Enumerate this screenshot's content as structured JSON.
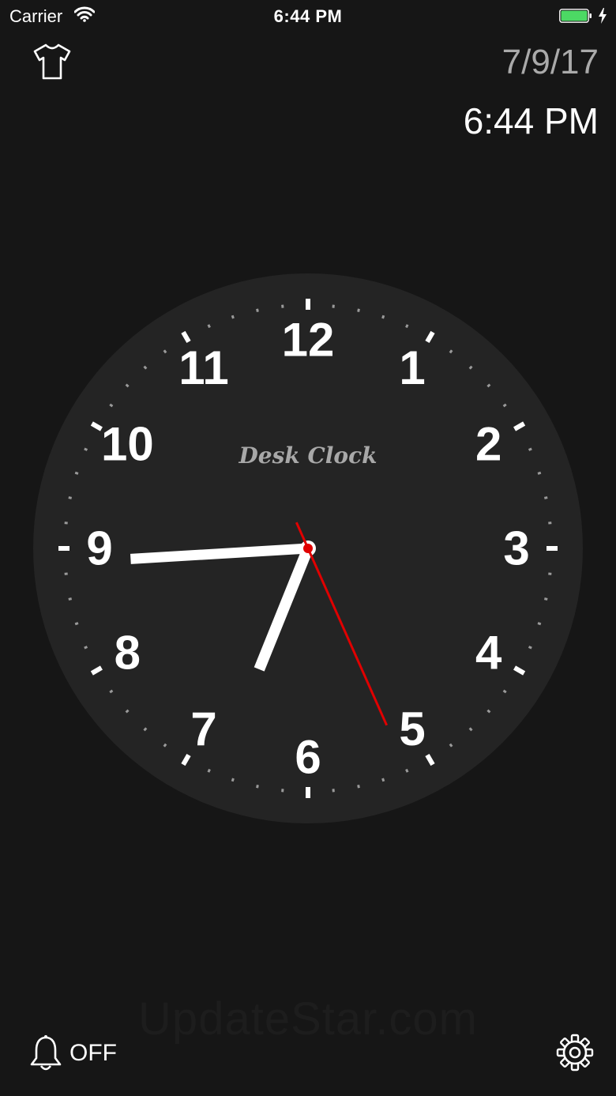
{
  "status_bar": {
    "carrier": "Carrier",
    "time": "6:44 PM",
    "battery_color": "#4cd964"
  },
  "header": {
    "date": "7/9/17",
    "time": "6:44 PM"
  },
  "clock": {
    "brand": "Desk Clock",
    "numerals": [
      "12",
      "1",
      "2",
      "3",
      "4",
      "5",
      "6",
      "7",
      "8",
      "9",
      "10",
      "11"
    ],
    "hour": 6,
    "minute": 44,
    "second": 26,
    "face_color": "#242424",
    "hand_color": "#ffffff",
    "second_hand_color": "#e00000"
  },
  "footer": {
    "alarm_label": "OFF",
    "watermark": "UpdateStar.com"
  },
  "icons": {
    "theme": "t-shirt-icon",
    "alarm": "bell-icon",
    "settings": "gear-icon"
  }
}
